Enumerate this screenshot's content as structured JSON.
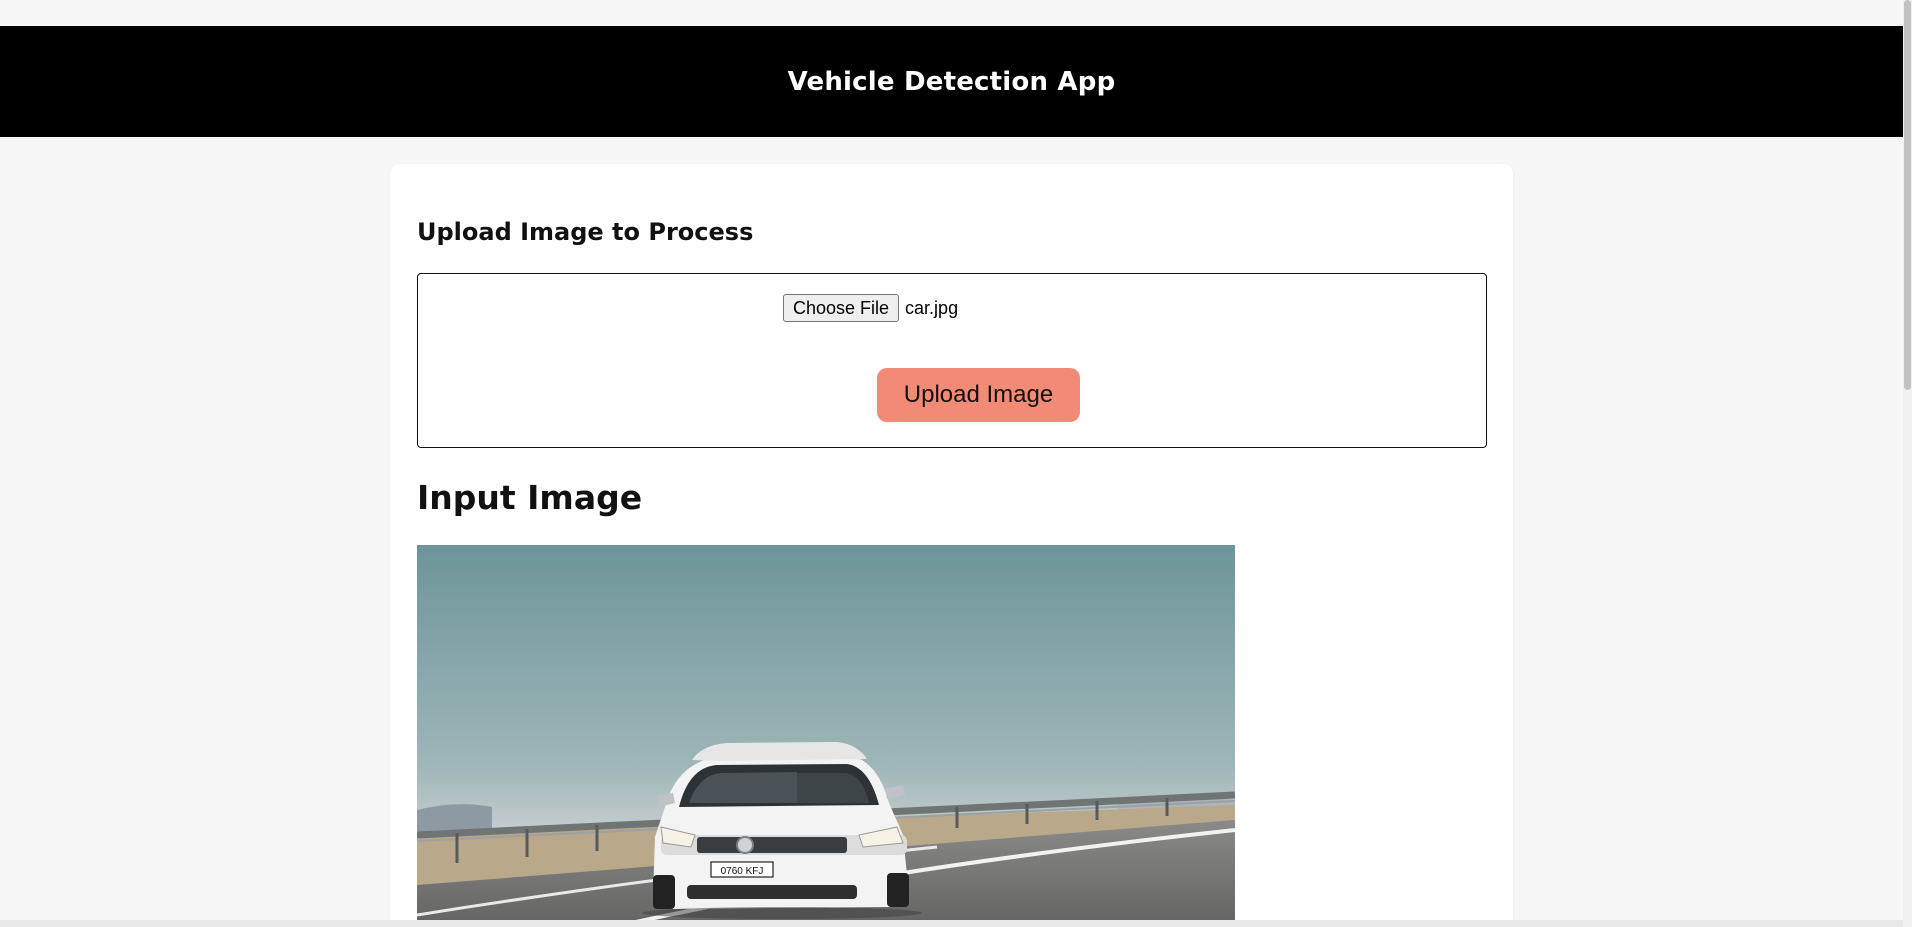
{
  "app": {
    "title": "Vehicle Detection App"
  },
  "upload": {
    "heading": "Upload Image to Process",
    "choose_file_label": "Choose File",
    "file_name": "car.jpg",
    "upload_button_label": "Upload Image"
  },
  "input_image": {
    "heading": "Input Image",
    "plate_text": "0760 KFJ"
  },
  "colors": {
    "header_bg": "#000000",
    "upload_button": "#f28a75",
    "page_bg": "#f7f7f7",
    "card_bg": "#ffffff"
  }
}
